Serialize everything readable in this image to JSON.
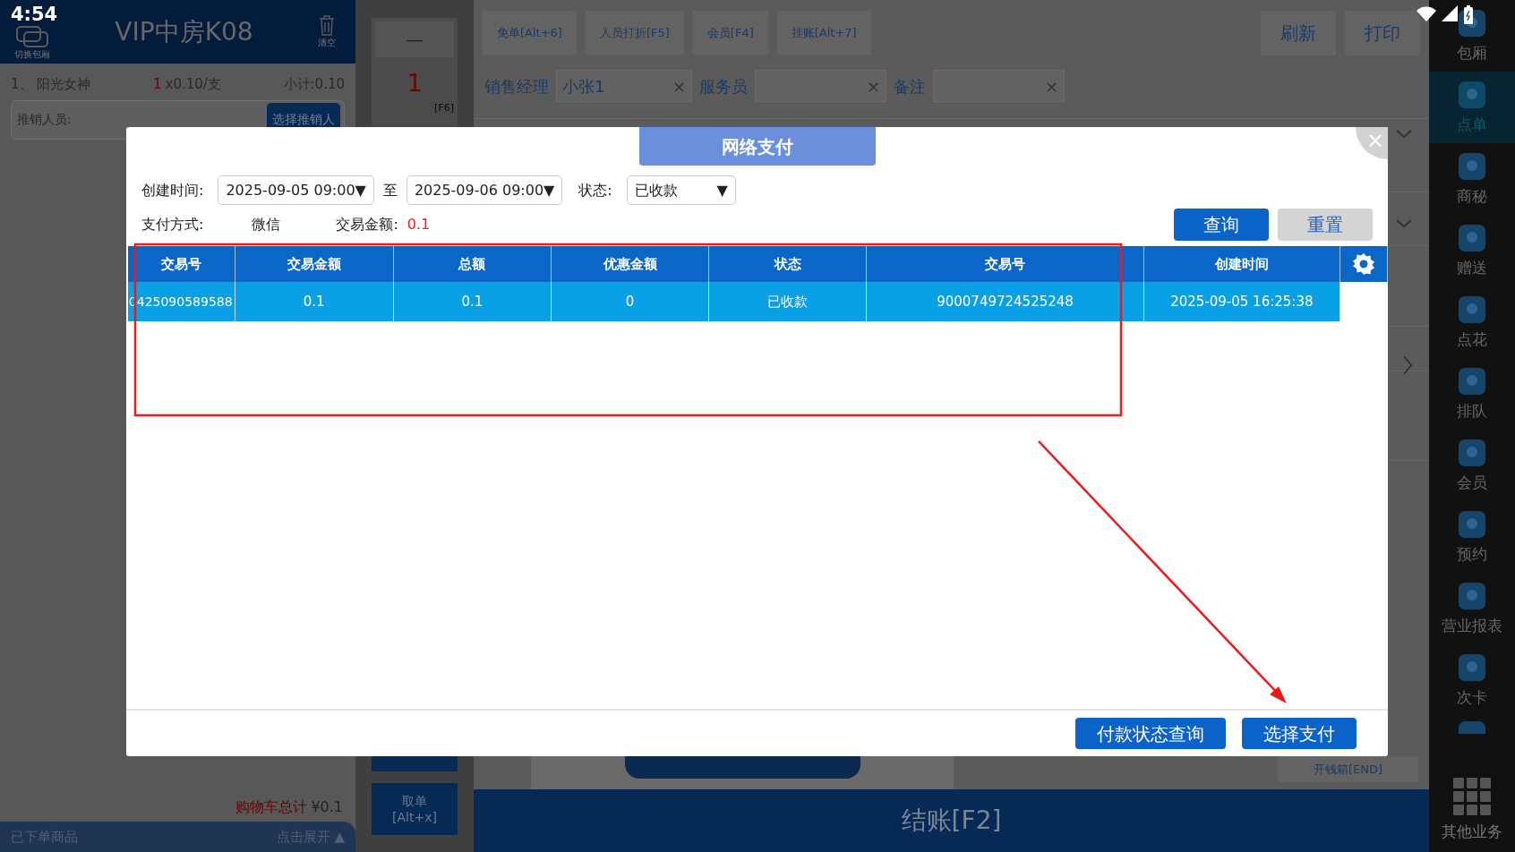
{
  "status_bar": {
    "time": "4:54"
  },
  "room_panel": {
    "switch_label": "切换包厢",
    "title": "VIP中房K08",
    "clear_label": "清空",
    "items": [
      {
        "index": "1、",
        "name": "阳光女神",
        "qty": "1",
        "price": "x0.10/支",
        "subtotal": "小计:0.10"
      }
    ],
    "promoter_label": "推销人员:",
    "promoter_button": "选择推销人",
    "cart_total_label": "购物车总计",
    "cart_total_value": "¥0.1",
    "ordered_label": "已下单商品",
    "expand_label": "点击展开",
    "expand_arrow": "▲"
  },
  "quantity": {
    "minus": "—",
    "value": "1",
    "key": "[F6]",
    "take_order": "取单",
    "take_order_key": "[Alt+x]"
  },
  "toolbar": {
    "buttons": [
      "免单[Alt+6]",
      "人员打折[F5]",
      "会员[F4]",
      "挂账[Alt+7]"
    ],
    "right_buttons": [
      "刷新",
      "打印"
    ]
  },
  "fields": [
    {
      "label": "销售经理",
      "value": "小张1",
      "clear": "×"
    },
    {
      "label": "服务员",
      "clear": "×"
    },
    {
      "label": "备注",
      "clear": "×"
    }
  ],
  "drawer_button": "开钱箱[END]",
  "checkout_button": "结账[F2]",
  "sidebar": {
    "items": [
      {
        "label": "包厢",
        "selected": false
      },
      {
        "label": "点单",
        "selected": true
      },
      {
        "label": "商秘",
        "selected": false
      },
      {
        "label": "赠送",
        "selected": false
      },
      {
        "label": "点花",
        "selected": false
      },
      {
        "label": "排队",
        "selected": false
      },
      {
        "label": "会员",
        "selected": false
      },
      {
        "label": "预约",
        "selected": false
      },
      {
        "label": "营业报表",
        "selected": false
      },
      {
        "label": "次卡",
        "selected": false
      }
    ],
    "more": "其他业务"
  },
  "dialog": {
    "title": "网络支付",
    "close": "×",
    "filters": {
      "created_label": "创建时间:",
      "from": "2025-09-05 09:00▼",
      "to_label": "至",
      "to": "2025-09-06 09:00▼",
      "status_label": "状态:",
      "status": "已收款",
      "status_arrow": "▼",
      "method_label": "支付方式:",
      "method": "微信",
      "amount_label": "交易金额:",
      "amount": "0.1"
    },
    "query_button": "查询",
    "reset_button": "重置",
    "table": {
      "columns": [
        "交易号",
        "交易金额",
        "总额",
        "优惠金额",
        "状态",
        "交易号",
        "创建时间"
      ],
      "rows": [
        {
          "cells": [
            "0425090589588",
            "0.1",
            "0.1",
            "0",
            "已收款",
            "9000749724525248",
            "2025-09-05 16:25:38"
          ],
          "selected": true
        }
      ]
    },
    "footer_buttons": [
      "付款状态查询",
      "选择支付"
    ]
  }
}
